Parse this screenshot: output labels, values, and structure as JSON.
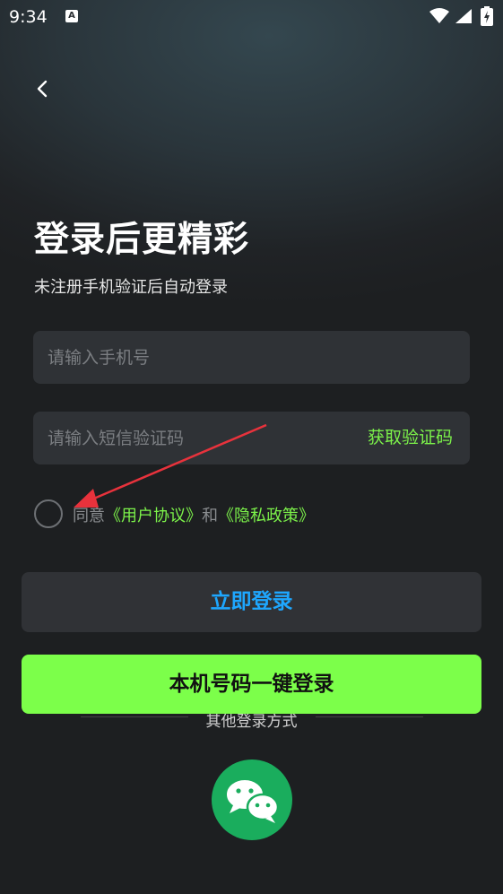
{
  "status_bar": {
    "time": "9:34",
    "notif_glyph": "A"
  },
  "header": {
    "back_icon": "chevron-left-icon"
  },
  "title": "登录后更精彩",
  "subtitle": "未注册手机验证后自动登录",
  "phone_input": {
    "placeholder": "请输入手机号",
    "value": ""
  },
  "code_input": {
    "placeholder": "请输入短信验证码",
    "value": "",
    "get_code_label": "获取验证码"
  },
  "agreement": {
    "prefix": "同意",
    "user_agreement": "《用户协议》",
    "and": "和",
    "privacy_policy": "《隐私政策》",
    "checked": false
  },
  "login_button": "立即登录",
  "other_methods_label": "其他登录方式",
  "onekey_button": "本机号码一键登录",
  "colors": {
    "accent_green": "#7cf24a",
    "button_green": "#7cff4a",
    "login_blue": "#1ea7ff",
    "wechat": "#1aad5d",
    "arrow": "#e8323c"
  }
}
